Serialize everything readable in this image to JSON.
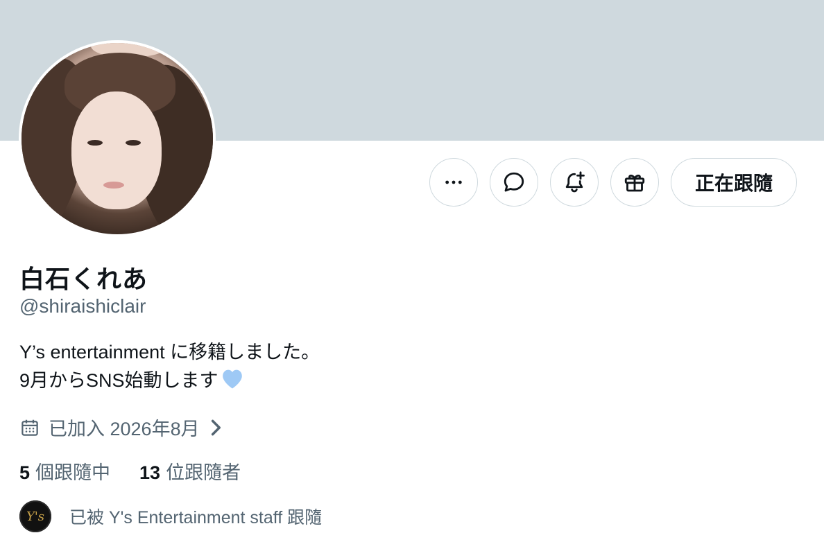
{
  "profile": {
    "display_name": "白石くれあ",
    "handle": "@shiraishiclair",
    "bio_line1": "Y’s entertainment に移籍しました。",
    "bio_line2": "9月からSNS始動します",
    "joined": "已加入 2026年8月",
    "following_count": "5",
    "following_label": "個跟隨中",
    "followers_count": "13",
    "followers_label": "位跟隨者",
    "followed_by": "已被 Y's Entertainment staff 跟隨",
    "followed_by_avatar_text": "Y's"
  },
  "actions": {
    "more_icon": "more-horizontal-icon",
    "message_icon": "message-bubble-icon",
    "notify_icon": "bell-plus-icon",
    "gift_icon": "gift-icon",
    "follow_label": "正在跟隨"
  },
  "colors": {
    "banner": "#cfd9de",
    "secondary_text": "#536471",
    "primary_text": "#0f1419",
    "heart": "#9ec9f5"
  }
}
